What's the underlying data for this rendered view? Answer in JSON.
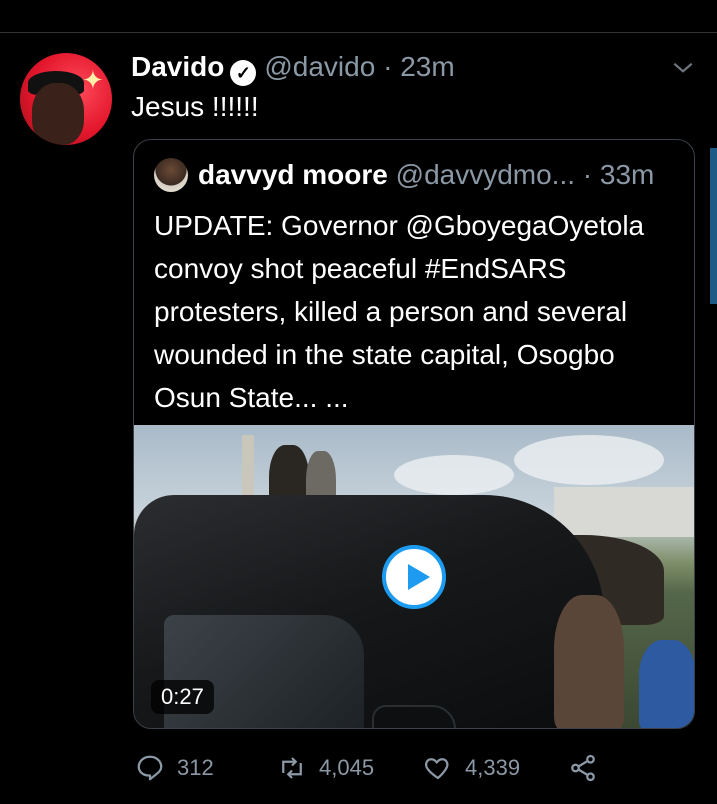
{
  "tweet": {
    "display_name": "Davido",
    "handle": "@davido",
    "separator": "·",
    "time": "23m",
    "text": "Jesus !!!!!!",
    "verified_glyph": "✓",
    "avatar_star": "✦"
  },
  "quoted_tweet": {
    "display_name": "davvyd moore",
    "handle": "@davvydmo...",
    "separator": "·",
    "time": "33m",
    "text": "UPDATE: Governor @GboyegaOyetola convoy shot peaceful #EndSARS protesters, killed a person and several wounded in the state capital, Osogbo Osun State... ...",
    "media": {
      "type": "video",
      "duration": "0:27"
    }
  },
  "actions": {
    "reply_count": "312",
    "retweet_count": "4,045",
    "like_count": "4,339"
  },
  "colors": {
    "background": "#000000",
    "muted_text": "#8b98a5",
    "accent_blue": "#1d9bf0",
    "border": "#3b4148"
  },
  "icons": [
    "verified-badge-icon",
    "chevron-down-icon",
    "play-icon",
    "reply-icon",
    "retweet-icon",
    "like-icon",
    "share-icon"
  ]
}
